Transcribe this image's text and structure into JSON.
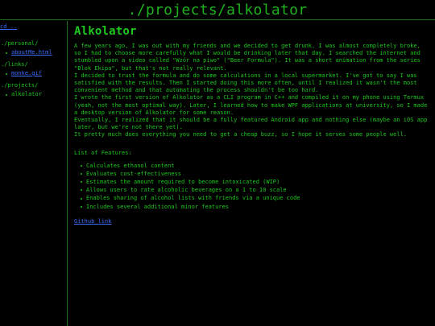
{
  "header": {
    "title": "./projects/alkolator"
  },
  "sidebar": {
    "cd_up": "cd ..",
    "groups": [
      {
        "dir": "./personal/",
        "items": [
          {
            "label": "aboutMe.html",
            "link": true
          }
        ]
      },
      {
        "dir": "./links/",
        "items": [
          {
            "label": "monke.gif",
            "link": true
          }
        ]
      },
      {
        "dir": "./projects/",
        "items": [
          {
            "label": "alkolator",
            "link": false
          }
        ]
      }
    ]
  },
  "main": {
    "title": "Alkolator",
    "paragraphs": [
      "A few years ago, I was out with my friends and we decided to get drunk. I was almost completely broke, so I had to choose more carefully what I would be drinking later that day. I searched the internet and stumbled upon a video called \"Wzór na piwo\" (\"Beer Formula\"). It was a short animation from the series \"Blok Ekipa\", but that's not really relevant.",
      "I decided to trust the formula and do some calculations in a local supermarket. I've got to say I was satisfied with the results. Then I started doing this more often, until I realized it wasn't the most convenient method and that automating the process shouldn't be too hard.",
      "I wrote the first version of Alkolator as a CLI program in C++ and compiled it on my phone using Termux (yeah, not the most optimal way). Later, I learned how to make WPF applications at university, so I made a desktop version of Alkolator for some reason.",
      "Eventually, I realized that it should be a fully featured Android app and nothing else (maybe an iOS app later, but we're not there yet).",
      "It pretty much does everything you need to get a cheap buzz, so I hope it serves some people well."
    ],
    "features_heading": "List of Features:",
    "features": [
      "Calculates ethanol content",
      "Evaluates cost-effectiveness",
      "Estimates the amount required to become intoxicated (WIP)",
      "Allows users to rate alcoholic beverages on a 1 to 10 scale",
      "Enables sharing of alcohol lists with friends via a unique code",
      "Includes several additional minor features"
    ],
    "github_link": "Github link"
  },
  "colors": {
    "background": "#000000",
    "text": "#1ec81e",
    "link": "#3b6cff",
    "border": "#1f6b1f"
  }
}
